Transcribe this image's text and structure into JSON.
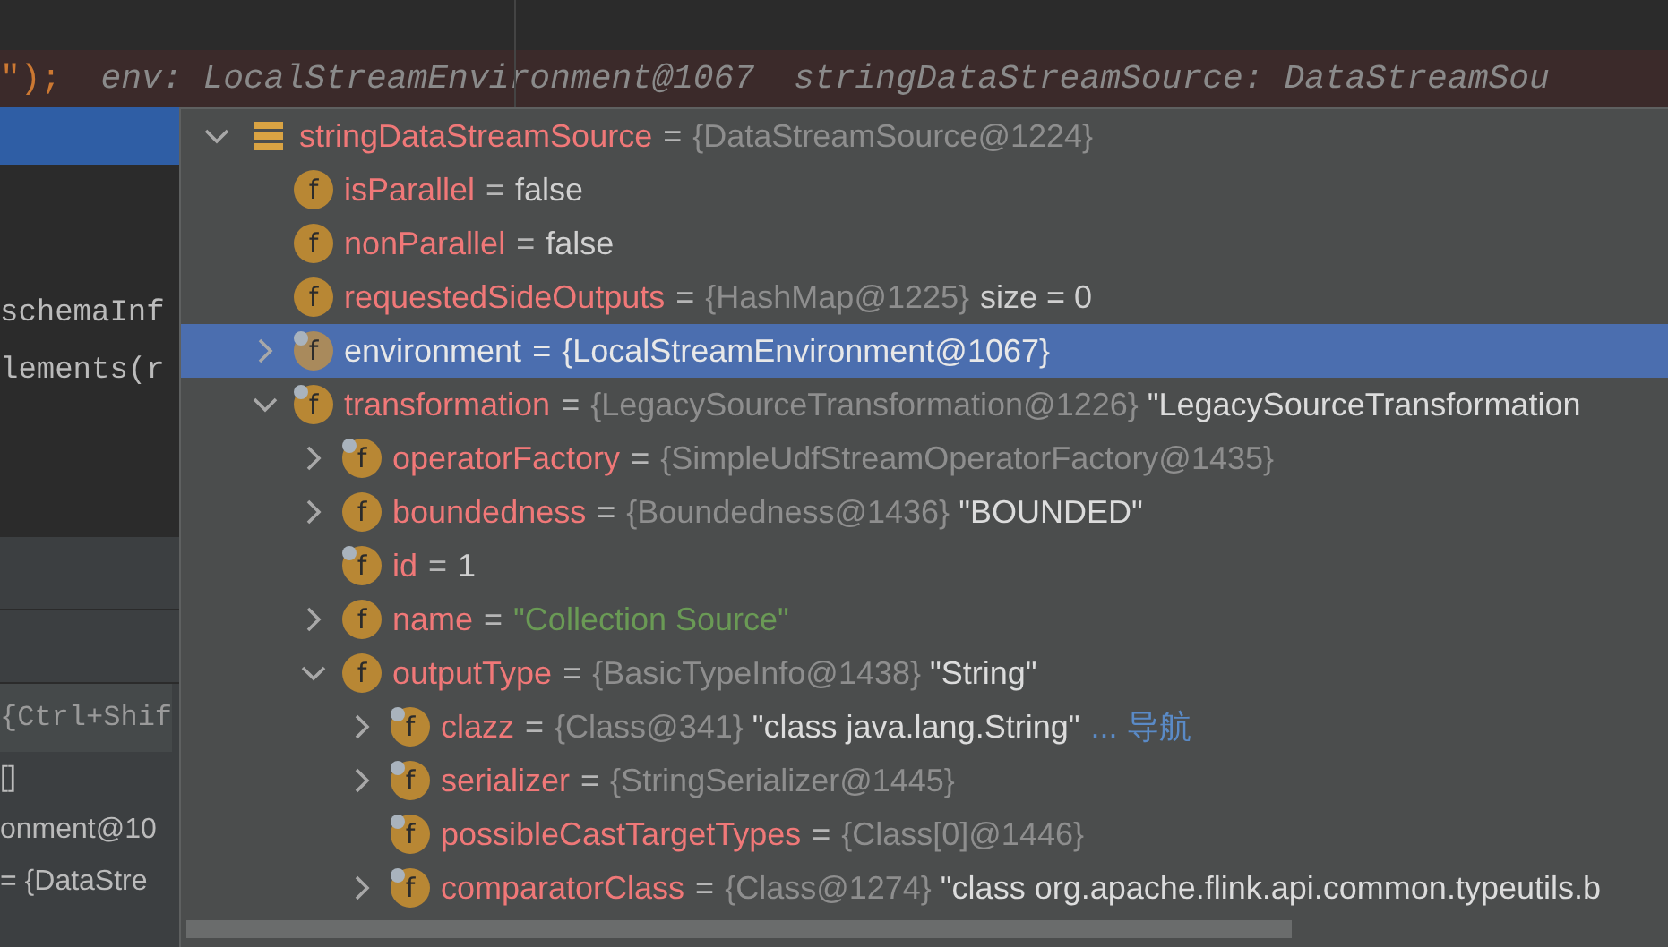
{
  "editor": {
    "top_line": [
      {
        "kind": "code",
        "text": "\");"
      },
      {
        "kind": "hint",
        "text": "env: LocalStreamEnvironment@1067"
      },
      {
        "kind": "hint",
        "text": "stringDataStreamSource: DataStreamSou"
      }
    ],
    "code_lines": [
      "schemaInf",
      "lements(r"
    ]
  },
  "bottom_panel": {
    "rows": [
      {
        "kind": "field",
        "text": "{Ctrl+Shif"
      },
      {
        "kind": "text",
        "text": "[]"
      },
      {
        "kind": "text",
        "text": "onment@10"
      },
      {
        "kind": "text",
        "text": "= {DataStre"
      }
    ]
  },
  "variables_popup": {
    "tree": [
      {
        "name": "stringDataStreamSource",
        "kind": "variable",
        "selected": false,
        "expanded": true,
        "value": [
          {
            "kind": "op",
            "text": "="
          },
          {
            "kind": "ref",
            "text": "{DataStreamSource@1224}"
          }
        ],
        "children": [
          {
            "name": "isParallel",
            "kind": "field",
            "badge": "f",
            "final": false,
            "selected": false,
            "value": [
              {
                "kind": "op",
                "text": "="
              },
              {
                "kind": "plain",
                "text": "false"
              }
            ]
          },
          {
            "name": "nonParallel",
            "kind": "field",
            "badge": "f",
            "final": false,
            "selected": false,
            "value": [
              {
                "kind": "op",
                "text": "="
              },
              {
                "kind": "plain",
                "text": "false"
              }
            ]
          },
          {
            "name": "requestedSideOutputs",
            "kind": "field",
            "badge": "f",
            "final": false,
            "selected": false,
            "value": [
              {
                "kind": "op",
                "text": "="
              },
              {
                "kind": "ref",
                "text": "{HashMap@1225}"
              },
              {
                "kind": "plain",
                "text": "size = 0"
              }
            ]
          },
          {
            "name": "environment",
            "kind": "field",
            "badge": "f",
            "final": true,
            "selected": true,
            "expanded": false,
            "value": [
              {
                "kind": "op",
                "text": "="
              },
              {
                "kind": "plain",
                "text": "{LocalStreamEnvironment@1067}"
              }
            ]
          },
          {
            "name": "transformation",
            "kind": "field",
            "badge": "f",
            "final": true,
            "selected": false,
            "expanded": true,
            "value": [
              {
                "kind": "op",
                "text": "="
              },
              {
                "kind": "ref",
                "text": "{LegacySourceTransformation@1226}"
              },
              {
                "kind": "str",
                "text": "\"LegacySourceTransformation"
              }
            ],
            "children": [
              {
                "name": "operatorFactory",
                "kind": "field",
                "badge": "f",
                "final": true,
                "selected": false,
                "expanded": false,
                "value": [
                  {
                    "kind": "op",
                    "text": "="
                  },
                  {
                    "kind": "ref",
                    "text": "{SimpleUdfStreamOperatorFactory@1435}"
                  }
                ]
              },
              {
                "name": "boundedness",
                "kind": "field",
                "badge": "f",
                "final": false,
                "selected": false,
                "expanded": false,
                "value": [
                  {
                    "kind": "op",
                    "text": "="
                  },
                  {
                    "kind": "ref",
                    "text": "{Boundedness@1436}"
                  },
                  {
                    "kind": "str",
                    "text": "\"BOUNDED\""
                  }
                ]
              },
              {
                "name": "id",
                "kind": "field",
                "badge": "f",
                "final": true,
                "selected": false,
                "value": [
                  {
                    "kind": "op",
                    "text": "="
                  },
                  {
                    "kind": "plain",
                    "text": "1"
                  }
                ]
              },
              {
                "name": "name",
                "kind": "field",
                "badge": "f",
                "final": false,
                "selected": false,
                "expanded": false,
                "value": [
                  {
                    "kind": "op",
                    "text": "="
                  },
                  {
                    "kind": "string",
                    "text": "\"Collection Source\""
                  }
                ]
              },
              {
                "name": "outputType",
                "kind": "field",
                "badge": "f",
                "final": false,
                "selected": false,
                "expanded": true,
                "value": [
                  {
                    "kind": "op",
                    "text": "="
                  },
                  {
                    "kind": "ref",
                    "text": "{BasicTypeInfo@1438}"
                  },
                  {
                    "kind": "str",
                    "text": "\"String\""
                  }
                ],
                "children": [
                  {
                    "name": "clazz",
                    "kind": "field",
                    "badge": "f",
                    "final": true,
                    "selected": false,
                    "expanded": false,
                    "value": [
                      {
                        "kind": "op",
                        "text": "="
                      },
                      {
                        "kind": "ref",
                        "text": "{Class@341}"
                      },
                      {
                        "kind": "str",
                        "text": "\"class java.lang.String\""
                      },
                      {
                        "kind": "link",
                        "text": "... 导航"
                      }
                    ]
                  },
                  {
                    "name": "serializer",
                    "kind": "field",
                    "badge": "f",
                    "final": true,
                    "selected": false,
                    "expanded": false,
                    "value": [
                      {
                        "kind": "op",
                        "text": "="
                      },
                      {
                        "kind": "ref",
                        "text": "{StringSerializer@1445}"
                      }
                    ]
                  },
                  {
                    "name": "possibleCastTargetTypes",
                    "kind": "field",
                    "badge": "f",
                    "final": true,
                    "selected": false,
                    "value": [
                      {
                        "kind": "op",
                        "text": "="
                      },
                      {
                        "kind": "ref",
                        "text": "{Class[0]@1446}"
                      }
                    ]
                  },
                  {
                    "name": "comparatorClass",
                    "kind": "field",
                    "badge": "f",
                    "final": true,
                    "selected": false,
                    "expanded": false,
                    "value": [
                      {
                        "kind": "op",
                        "text": "="
                      },
                      {
                        "kind": "ref",
                        "text": "{Class@1274}"
                      },
                      {
                        "kind": "str",
                        "text": "\"class org.apache.flink.api.common.typeutils.b"
                      }
                    ]
                  }
                ]
              }
            ]
          }
        ]
      }
    ]
  }
}
